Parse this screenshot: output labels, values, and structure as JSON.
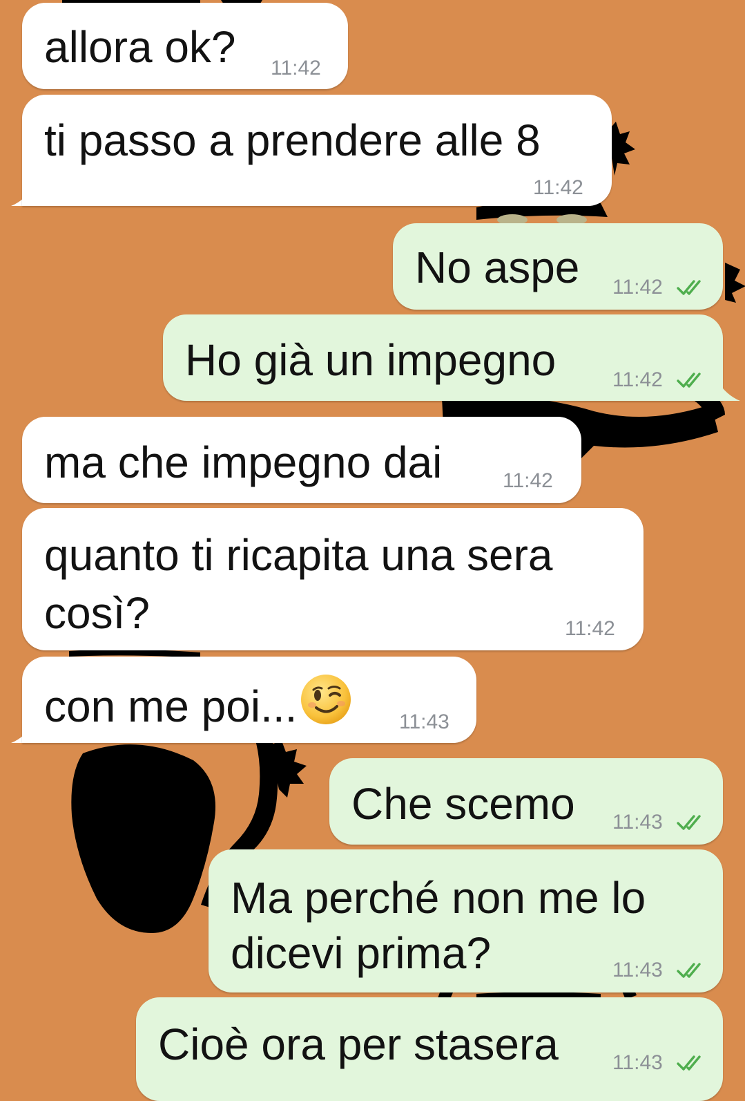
{
  "messages": [
    {
      "id": 1,
      "direction": "incoming",
      "text": "allora ok?",
      "time": "11:42"
    },
    {
      "id": 2,
      "direction": "incoming",
      "text": "ti passo a prendere alle 8",
      "time": "11:42"
    },
    {
      "id": 3,
      "direction": "outgoing",
      "text": "No aspe",
      "time": "11:42",
      "status": "read"
    },
    {
      "id": 4,
      "direction": "outgoing",
      "text": "Ho già un impegno",
      "time": "11:42",
      "status": "read"
    },
    {
      "id": 5,
      "direction": "incoming",
      "text": "ma che impegno dai",
      "time": "11:42"
    },
    {
      "id": 6,
      "direction": "incoming",
      "line1": "quanto ti ricapita una sera",
      "line2": "così?",
      "time": "11:42"
    },
    {
      "id": 7,
      "direction": "incoming",
      "text": "con me poi...",
      "emoji": "winking-face",
      "time": "11:43"
    },
    {
      "id": 8,
      "direction": "outgoing",
      "text": "Che scemo",
      "time": "11:43",
      "status": "read"
    },
    {
      "id": 9,
      "direction": "outgoing",
      "line1": "Ma perché non me lo",
      "line2": "dicevi prima?",
      "time": "11:43",
      "status": "read"
    },
    {
      "id": 10,
      "direction": "outgoing",
      "text": "Cioè ora per stasera",
      "time": "11:43",
      "status": "read"
    }
  ],
  "colors": {
    "wallpaper": "#d98c4e",
    "incoming_bubble": "#ffffff",
    "outgoing_bubble": "#e2f6dc",
    "read_ticks": "#4fae4e",
    "timestamp": "#8c9096"
  },
  "wallpaper_motif": "black-cat-silhouette"
}
